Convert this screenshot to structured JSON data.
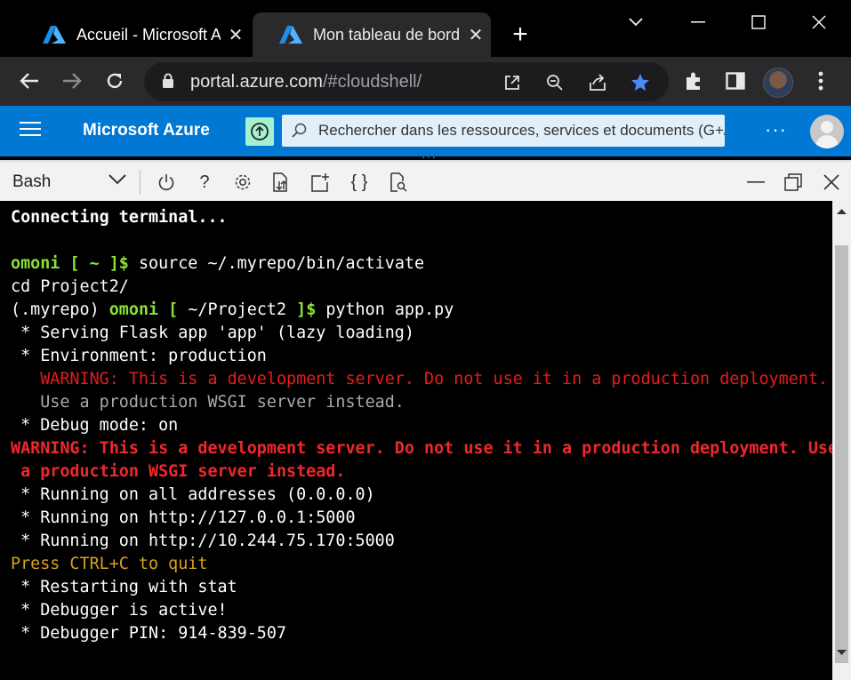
{
  "browser": {
    "tabs": [
      {
        "title": "Accueil - Microsoft Azure",
        "active": false
      },
      {
        "title": "Mon tableau de bord - Microsoft Azure",
        "active": true
      }
    ],
    "new_tab_label": "+",
    "url_host": "portal.azure.com",
    "url_path": "/#cloudshell/",
    "toolbar_icons": [
      "open-in-app-icon",
      "zoom-icon",
      "share-icon",
      "bookmark-star-icon",
      "extensions-icon",
      "side-panel-icon",
      "profile-avatar",
      "menu-icon"
    ]
  },
  "azure": {
    "brand": "Microsoft Azure",
    "search_placeholder": "Rechercher dans les ressources, services et documents (G+/)",
    "more_label": "···",
    "accent_color": "#0078d4"
  },
  "shell": {
    "type": "Bash",
    "grip": "···",
    "icons": [
      "power-icon",
      "help-icon",
      "settings-icon",
      "upload-download-icon",
      "open-editor-icon",
      "braces-icon",
      "web-preview-icon"
    ]
  },
  "terminal": {
    "lines": [
      [
        {
          "t": "Connecting terminal...",
          "c": "wb"
        }
      ],
      [
        {
          "t": "",
          "c": "w"
        }
      ],
      [
        {
          "t": "omoni [ ~ ]$",
          "c": "g"
        },
        {
          "t": " source ~/.myrepo/bin/activate",
          "c": "w"
        }
      ],
      [
        {
          "t": "cd Project2/",
          "c": "w"
        }
      ],
      [
        {
          "t": "(.myrepo) ",
          "c": "w"
        },
        {
          "t": "omoni [ ",
          "c": "g"
        },
        {
          "t": "~/Project2",
          "c": "w"
        },
        {
          "t": " ]$",
          "c": "g"
        },
        {
          "t": " python app.py",
          "c": "w"
        }
      ],
      [
        {
          "t": " * Serving Flask app 'app' (lazy loading)",
          "c": "w"
        }
      ],
      [
        {
          "t": " * Environment: production",
          "c": "w"
        }
      ],
      [
        {
          "t": "   WARNING: This is a development server. Do not use it in a production deployment.",
          "c": "r"
        }
      ],
      [
        {
          "t": "   Use a production WSGI server instead.",
          "c": "gray"
        }
      ],
      [
        {
          "t": " * Debug mode: on",
          "c": "w"
        }
      ],
      [
        {
          "t": "WARNING: This is a development server. Do not use it in a production deployment. Use",
          "c": "rb"
        }
      ],
      [
        {
          "t": " a production WSGI server instead.",
          "c": "rb"
        }
      ],
      [
        {
          "t": " * Running on all addresses (0.0.0.0)",
          "c": "w"
        }
      ],
      [
        {
          "t": " * Running on http://127.0.0.1:5000",
          "c": "w"
        }
      ],
      [
        {
          "t": " * Running on http://10.244.75.170:5000",
          "c": "w"
        }
      ],
      [
        {
          "t": "Press CTRL+C to quit",
          "c": "y"
        }
      ],
      [
        {
          "t": " * Restarting with stat",
          "c": "w"
        }
      ],
      [
        {
          "t": " * Debugger is active!",
          "c": "w"
        }
      ],
      [
        {
          "t": " * Debugger PIN: 914-839-507",
          "c": "w"
        }
      ]
    ]
  }
}
